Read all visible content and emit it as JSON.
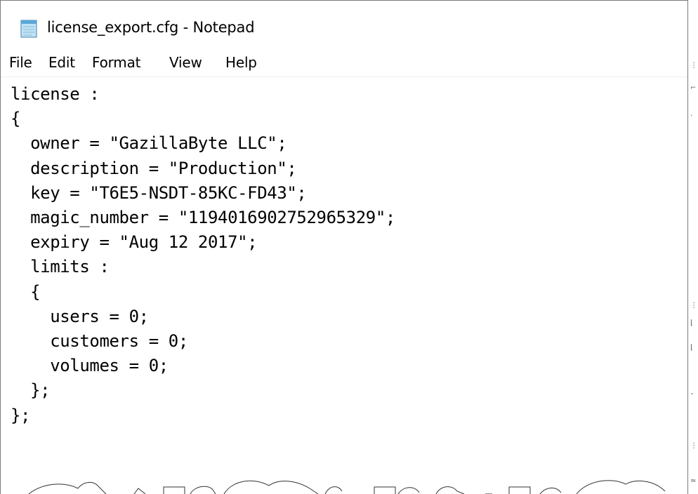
{
  "window": {
    "title": "license_export.cfg - Notepad",
    "icon": "notepad-icon"
  },
  "menu": {
    "items": [
      {
        "label": "File"
      },
      {
        "label": "Edit"
      },
      {
        "label": "Format"
      },
      {
        "label": "View"
      },
      {
        "label": "Help"
      }
    ]
  },
  "editor": {
    "text": "license :\n{\n  owner = \"GazillaByte LLC\";\n  description = \"Production\";\n  key = \"T6E5-NSDT-85KC-FD43\";\n  magic_number = \"1194016902752965329\";\n  expiry = \"Aug 12 2017\";\n  limits :\n  {\n    users = 0;\n    customers = 0;\n    volumes = 0;\n  };\n};"
  },
  "colors": {
    "text": "#000000",
    "background": "#ffffff",
    "border": "#7a7a7a"
  }
}
